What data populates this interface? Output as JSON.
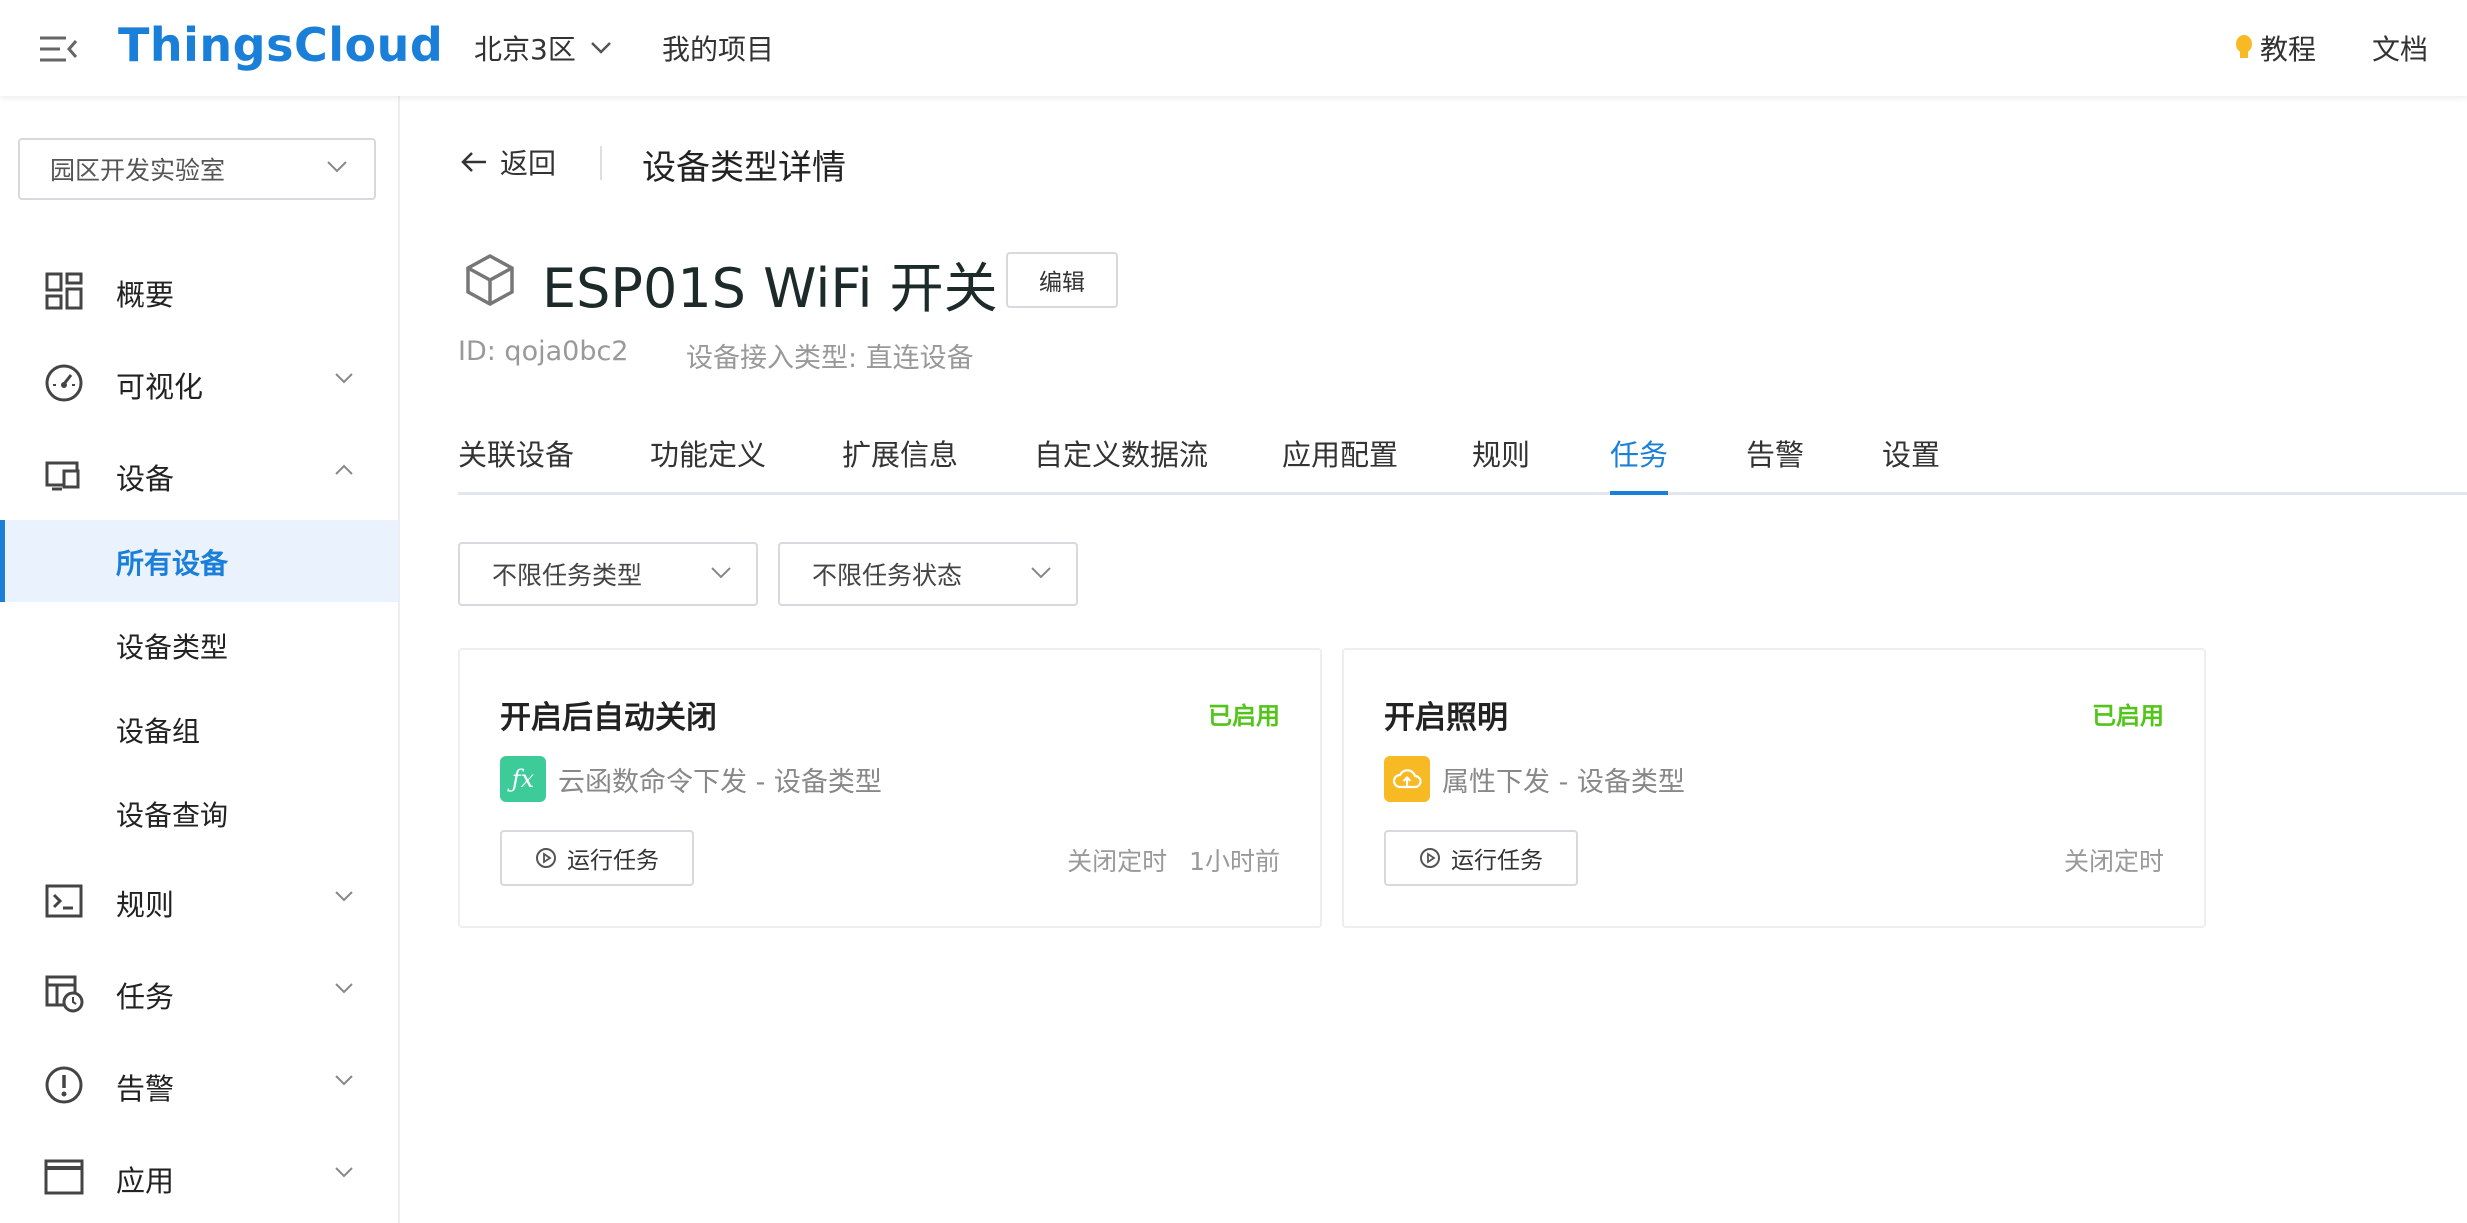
{
  "header": {
    "brand": "ThingsCloud",
    "region": "北京3区",
    "projects": "我的项目",
    "tutorial": "教程",
    "docs": "文档"
  },
  "sidebar": {
    "lab_select": "园区开发实验室",
    "items": [
      {
        "label": "概要",
        "icon": "dashboard-icon"
      },
      {
        "label": "可视化",
        "icon": "gauge-icon"
      },
      {
        "label": "设备",
        "icon": "device-icon"
      },
      {
        "label": "规则",
        "icon": "terminal-icon"
      },
      {
        "label": "任务",
        "icon": "task-clock-icon"
      },
      {
        "label": "告警",
        "icon": "alert-icon"
      },
      {
        "label": "应用",
        "icon": "window-icon"
      }
    ],
    "device_sub": [
      "所有设备",
      "设备类型",
      "设备组",
      "设备查询"
    ]
  },
  "main": {
    "back_label": "返回",
    "page_title": "设备类型详情",
    "device_name": "ESP01S WiFi 开关",
    "edit_label": "编辑",
    "id_text": "ID: qoja0bc2",
    "access_type": "设备接入类型: 直连设备",
    "tabs": [
      "关联设备",
      "功能定义",
      "扩展信息",
      "自定义数据流",
      "应用配置",
      "规则",
      "任务",
      "告警",
      "设置"
    ],
    "active_tab": "任务",
    "filters": {
      "task_type": "不限任务类型",
      "task_status": "不限任务状态"
    },
    "cards": [
      {
        "title": "开启后自动关闭",
        "status": "已启用",
        "type": "云函数命令下发 - 设备类型",
        "type_icon": "function-fx-icon",
        "type_color": "#3ecb9a",
        "run_label": "运行任务",
        "schedule": "关闭定时",
        "last_run": "1小时前"
      },
      {
        "title": "开启照明",
        "status": "已启用",
        "type": "属性下发 - 设备类型",
        "type_icon": "cloud-upload-icon",
        "type_color": "#f7b924",
        "run_label": "运行任务",
        "schedule": "关闭定时",
        "last_run": ""
      }
    ]
  },
  "colors": {
    "accent": "#1a7fd9",
    "enabled": "#52c41a",
    "active_bg": "#eaf2fd"
  }
}
